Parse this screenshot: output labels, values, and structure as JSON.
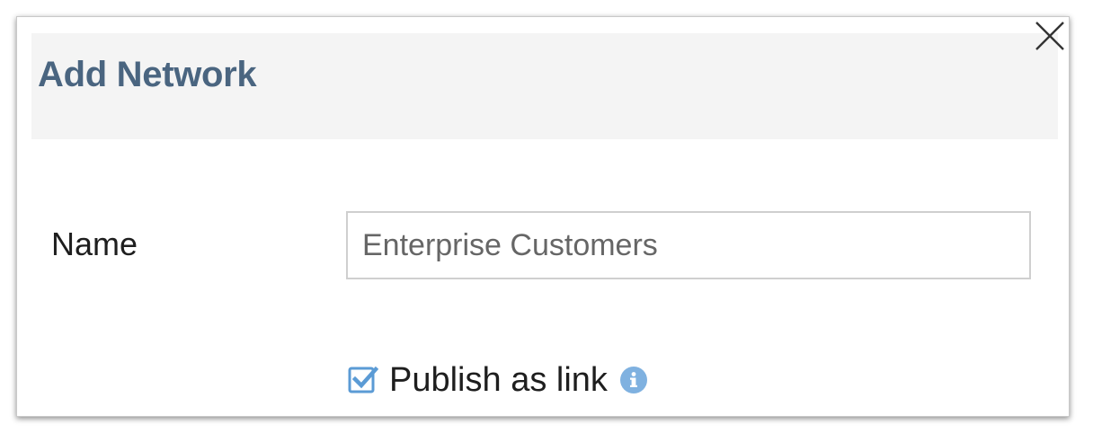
{
  "dialog": {
    "title": "Add Network",
    "close_icon": "close-icon"
  },
  "form": {
    "name_label": "Name",
    "name_value": "Enterprise Customers",
    "publish_label": "Publish as link",
    "publish_checked": true,
    "checkbox_icon": "checkbox-checked-icon",
    "info_icon": "info-icon"
  },
  "colors": {
    "title": "#4a6580",
    "header_bg": "#f4f4f4",
    "checkbox": "#5b9bd5",
    "info": "#7fb1e0"
  }
}
